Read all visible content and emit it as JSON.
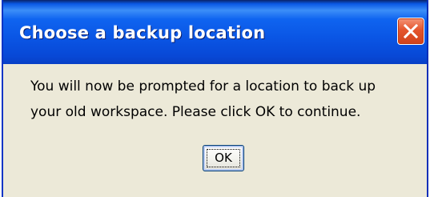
{
  "dialog": {
    "title": "Choose a backup location",
    "message_lines": [
      "You will now be prompted for a location to back up",
      "your old workspace.  Please click OK to continue."
    ],
    "ok_label": "OK"
  },
  "icons": {
    "close": "close-icon"
  },
  "colors": {
    "titlebar": "#0a55e4",
    "close_button": "#e4542c",
    "dialog_background": "#ece9d8",
    "border": "#0b35c6"
  }
}
